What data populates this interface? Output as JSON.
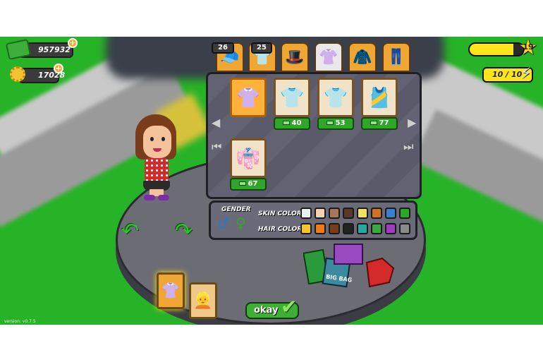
{
  "hud": {
    "cash": "957932",
    "coins": "17028",
    "level": "19",
    "xp_progress": 0.82,
    "energy": "10 / 10"
  },
  "tabs": [
    {
      "icon": "hat-icon",
      "count": "26",
      "label_glyph": "🧢"
    },
    {
      "icon": "shirt-icon",
      "count": "25",
      "label_glyph": "👕"
    },
    {
      "icon": "purple-hat-icon",
      "count": "",
      "label_glyph": "🎩"
    },
    {
      "icon": "top-icon",
      "count": "",
      "label_glyph": "👚"
    },
    {
      "icon": "jacket-icon",
      "count": "",
      "label_glyph": "🧥"
    },
    {
      "icon": "pants-icon",
      "count": "",
      "label_glyph": "👖"
    }
  ],
  "items": [
    {
      "icon": "red-polka-top-icon",
      "glyph": "👚",
      "price": "",
      "selected": true
    },
    {
      "icon": "blue-shirt-icon",
      "glyph": "👕",
      "price": "40",
      "selected": false
    },
    {
      "icon": "white-shirt-icon",
      "glyph": "👕",
      "price": "53",
      "selected": false
    },
    {
      "icon": "orange-top-icon",
      "glyph": "🎽",
      "price": "77",
      "selected": false
    },
    {
      "icon": "red-dress-icon",
      "glyph": "👘",
      "price": "67",
      "selected": false
    }
  ],
  "options": {
    "gender_label": "GENDER",
    "skin_label": "SKIN COLOR",
    "hair_label": "HAIR COLOR",
    "skin_colors": [
      "#e8eef2",
      "#f2d2b0",
      "#a8775a",
      "#5a3a26",
      "#f0e06a",
      "#d0702a",
      "#3a80d0",
      "#2fa52a"
    ],
    "hair_colors": [
      "#f2c430",
      "#f07a16",
      "#7a3d1c",
      "#222222",
      "#2aa6a0",
      "#3aa83a",
      "#a03ac0",
      "#8a8a8a"
    ]
  },
  "bottom": {
    "okay_label": "okay",
    "bag_text": "BIG BAG"
  },
  "version": "version: v0.7.5"
}
